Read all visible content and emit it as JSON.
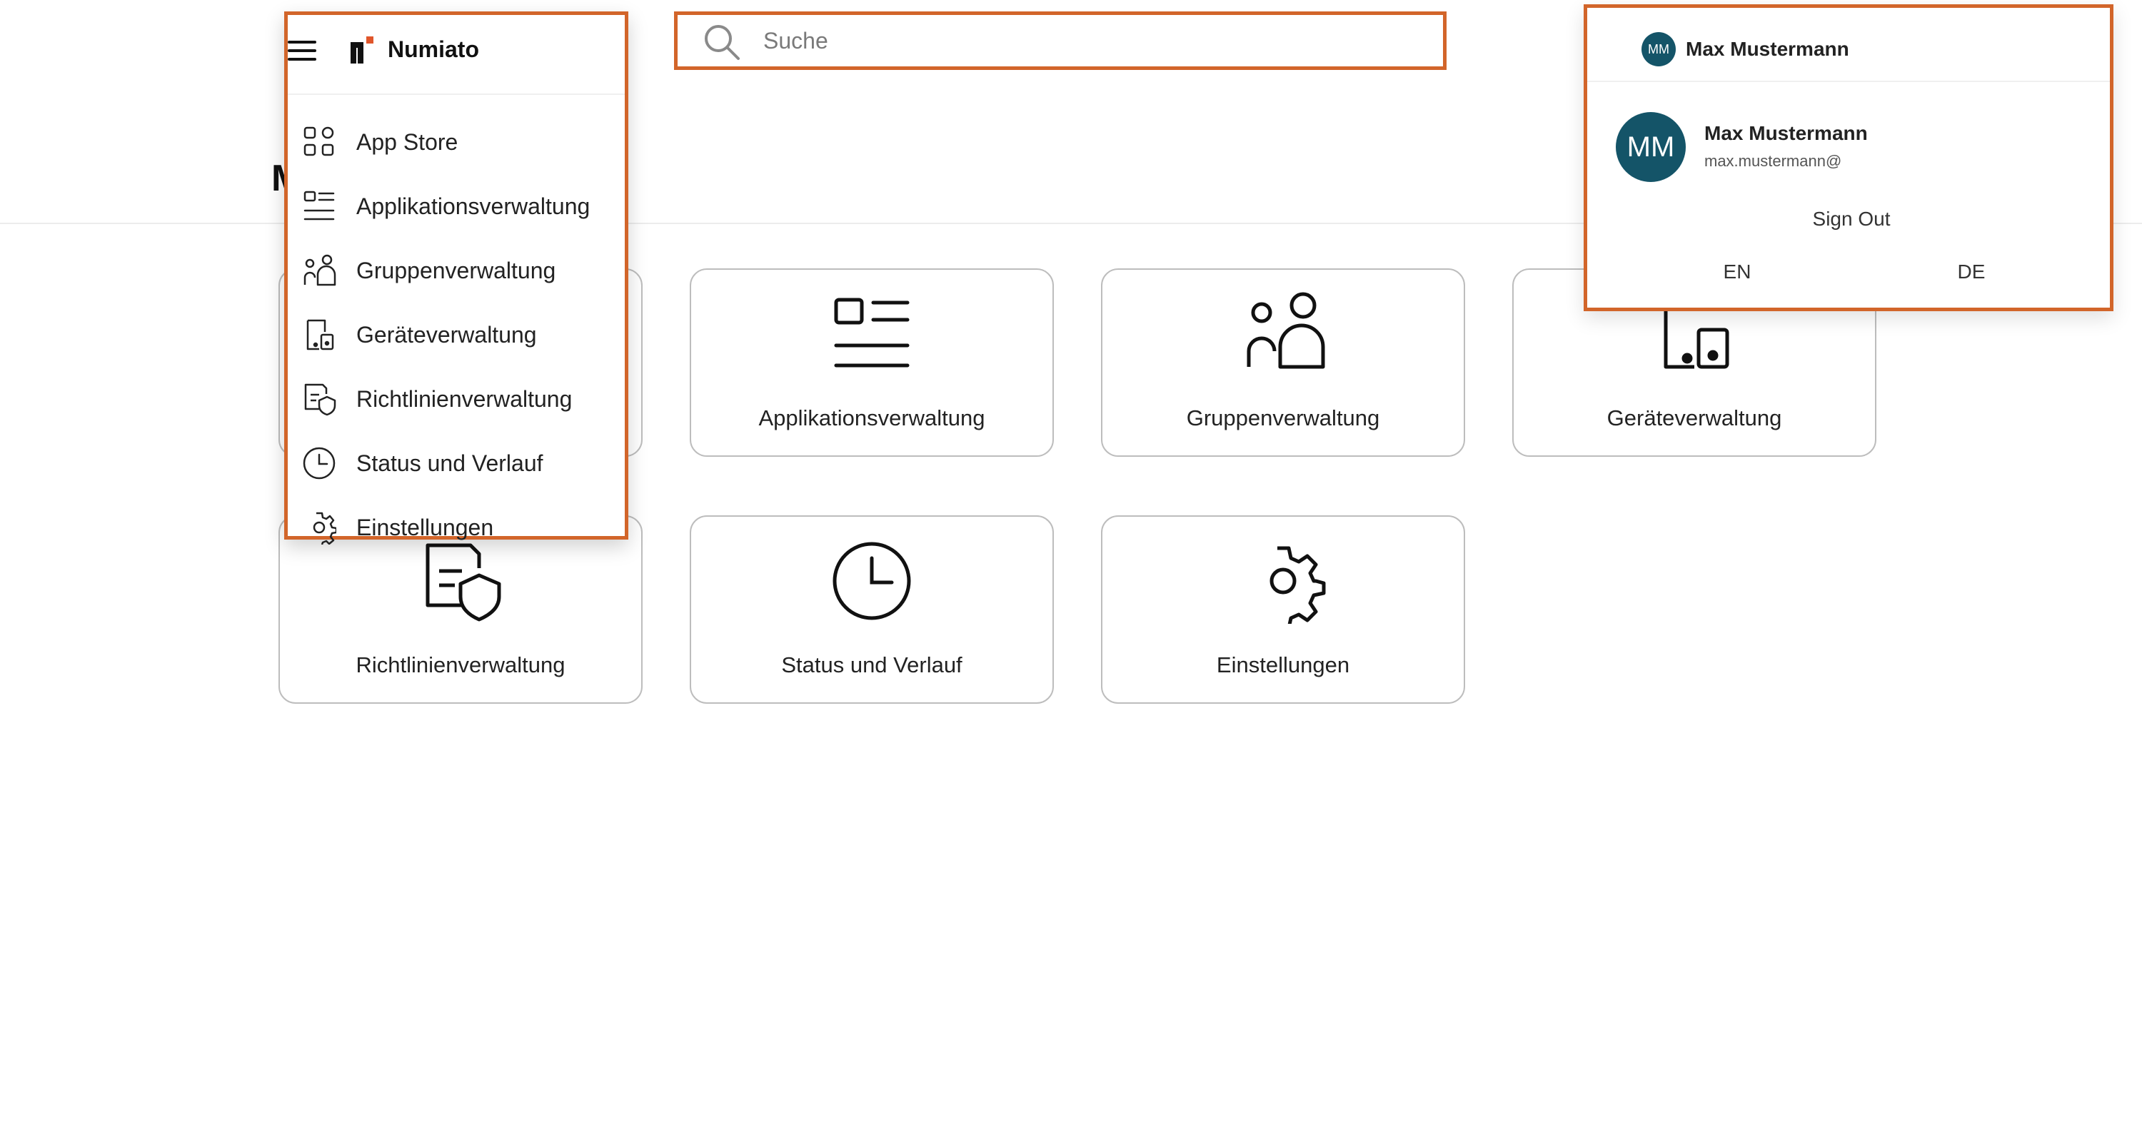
{
  "app": {
    "brand_name": "Numiato",
    "page_title": "M"
  },
  "search": {
    "value": "",
    "placeholder": "Suche"
  },
  "nav_menu": {
    "items": [
      {
        "label": "App Store",
        "icon": "app-store-grid-icon"
      },
      {
        "label": "Applikationsverwaltung",
        "icon": "application-list-icon"
      },
      {
        "label": "Gruppenverwaltung",
        "icon": "group-people-icon"
      },
      {
        "label": "Geräteverwaltung",
        "icon": "devices-icon"
      },
      {
        "label": "Richtlinienverwaltung",
        "icon": "policy-shield-icon"
      },
      {
        "label": "Status und Verlauf",
        "icon": "clock-history-icon"
      },
      {
        "label": "Einstellungen",
        "icon": "gear-icon"
      }
    ]
  },
  "tiles": [
    {
      "label": "Applikationsverwaltung",
      "icon": "application-list-icon"
    },
    {
      "label": "Gruppenverwaltung",
      "icon": "group-people-icon"
    },
    {
      "label": "Geräteverwaltung",
      "icon": "devices-icon"
    },
    {
      "label": "Richtlinienverwaltung",
      "icon": "policy-shield-icon"
    },
    {
      "label": "Status und Verlauf",
      "icon": "clock-history-icon"
    },
    {
      "label": "Einstellungen",
      "icon": "gear-icon"
    }
  ],
  "account": {
    "initials": "MM",
    "name": "Max Mustermann",
    "email": "max.mustermann@",
    "sign_out_label": "Sign Out",
    "languages": [
      "EN",
      "DE"
    ],
    "avatar_color": "#145468"
  },
  "colors": {
    "highlight": "#d2652a",
    "brand_accent": "#e0562b"
  }
}
